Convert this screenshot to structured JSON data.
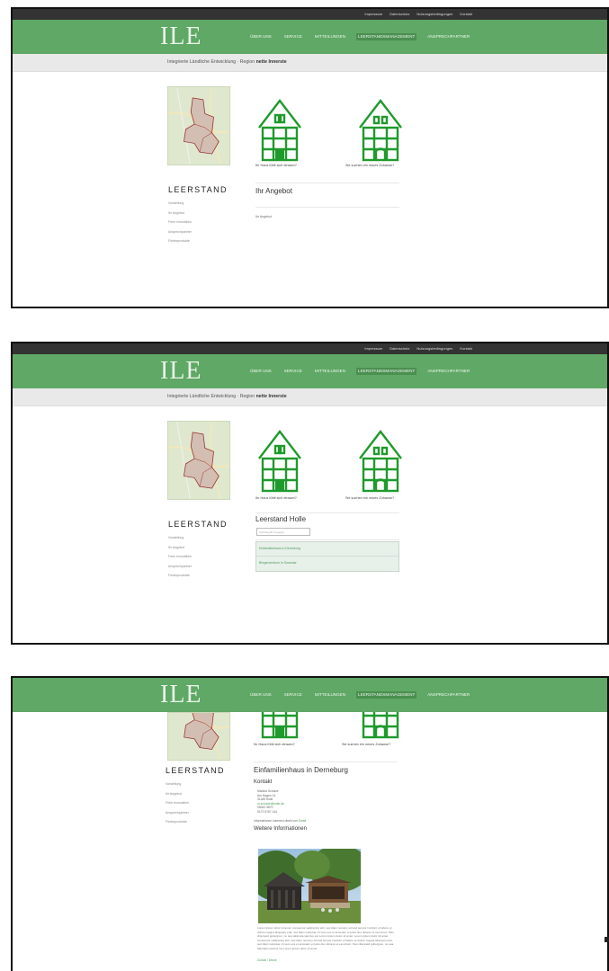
{
  "site": {
    "logo": "ILE",
    "top_links": [
      "Impressum",
      "Datenschutz",
      "Nutzungsbedingungen",
      "Kontakt"
    ],
    "nav": [
      "ÜBER UNS",
      "SERVICE",
      "MITTEILUNGEN",
      "LEERSTANDSMANAGEMENT",
      "ANSPRECHPARTNER"
    ],
    "breadcrumb_prefix": "Integrierte Ländliche Entwicklung · Region ",
    "breadcrumb_strong": "nette Innerste",
    "section_title": "LEERSTAND",
    "side_menu": [
      "Vorstellung",
      "Ihr Angebot",
      "Freie Immobilien",
      "Ansprechpartner",
      "Förderprodukte"
    ],
    "house1_caption": "Ihr Haus fühlt sich einsam?",
    "house2_caption": "Sie suchen ein neues Zuhause?"
  },
  "screen1": {
    "title": "Ihr Angebot",
    "body": "Ihr Angebot"
  },
  "screen2": {
    "title": "Leerstand Holle",
    "search_placeholder": "Suchbegriff eingeben",
    "results": [
      "Einfamilienhaus in Derneburg",
      "Bürgerzentrum in Sossmar"
    ]
  },
  "screen3": {
    "title": "Einfamilienhaus in Derneburg",
    "contact_heading": "Kontakt",
    "contact_lines": [
      "Martina Schulze",
      "Am Hagen 14",
      "31188 Holle",
      "m.schulze@holle.de",
      "05062 9870",
      "0172 5787 144"
    ],
    "more_info_prefix": "Informationen kommen direkt von",
    "more_info_link": "Email",
    "further_heading": "Weitere Informationen",
    "description": "Lorem ipsum dolor sit amet, consetetur sadipscing elitr, sed diam nonumy eirmod tempor invidunt ut labore et dolore magna aliquyam erat, sed diam voluptua. At vero eos et accusam et justo duo dolores et ea rebum. Stet clita kasd gubergren, no sea takimata sanctus est Lorem ipsum dolor sit amet. Lorem ipsum dolor sit amet, consetetur sadipscing elitr, sed diam nonumy eirmod tempor invidunt ut labore et dolore magna aliquyam erat, sed diam voluptua. At vero eos et accusam et justo duo dolores et ea rebum. Stet clita kasd gubergren, no sea takimata sanctus est Lorem ipsum dolor sit amet.",
    "back_link": "Zurück / Druck"
  }
}
